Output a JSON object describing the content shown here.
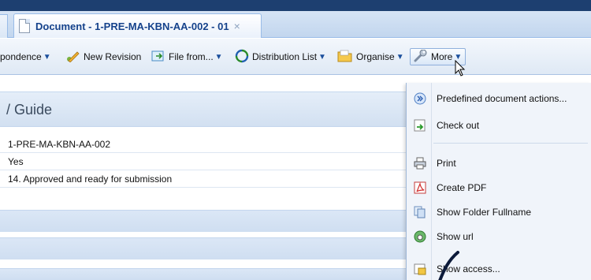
{
  "tab": {
    "title": "Document - 1-PRE-MA-KBN-AA-002 - 01",
    "close": "×"
  },
  "toolbar": {
    "correspondence": "pondence",
    "new_revision": "New Revision",
    "file_from": "File from...",
    "distribution_list": "Distribution List",
    "organise": "Organise",
    "more": "More"
  },
  "main": {
    "title": "/ Guide",
    "rows": [
      "1-PRE-MA-KBN-AA-002",
      "Yes",
      "14. Approved and ready for submission"
    ]
  },
  "menu": {
    "items": [
      {
        "label": "Predefined document actions...",
        "icon": "actions-icon"
      },
      {
        "label": "Check out",
        "icon": "checkout-icon"
      },
      {
        "label": "Print",
        "icon": "printer-icon"
      },
      {
        "label": "Create PDF",
        "icon": "pdf-icon"
      },
      {
        "label": "Show Folder Fullname",
        "icon": "folder-copy-icon"
      },
      {
        "label": "Show url",
        "icon": "globe-icon"
      },
      {
        "label": "Show access...",
        "icon": "access-icon"
      }
    ]
  },
  "colors": {
    "accent": "#15428b",
    "header_bg": "#1d3f70",
    "menu_bg": "#f0f4fa"
  }
}
